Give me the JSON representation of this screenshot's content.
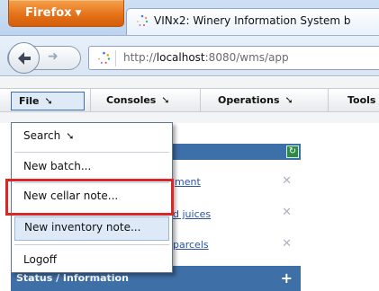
{
  "browser": {
    "firefox_button": "Firefox",
    "tab_title": "VINx2: Winery Information System b",
    "url_prefix": "http://",
    "url_host": "localhost",
    "url_rest": ":8080/wms/app"
  },
  "menubar": {
    "file": "File",
    "consoles": "Consoles",
    "operations": "Operations",
    "tools": "Tools"
  },
  "file_menu": {
    "search": "Search",
    "new_batch": "New batch...",
    "new_cellar_note": "New cellar note...",
    "new_inventory_note": "New inventory note...",
    "logoff": "Logoff"
  },
  "panel": {
    "link1": "ment",
    "link2": "d juices",
    "link3": "parcels"
  },
  "status": {
    "title": "Status / Information",
    "expand": "+"
  },
  "colors": {
    "firefox_orange": "#e36f16",
    "panel_blue": "#3d6fa8",
    "highlight_red": "#d92626",
    "hover_blue": "#dde9f6"
  },
  "icons": {
    "dropdown_arrow": "chevron-down-icon",
    "menu_arrow": "diagonal-arrow-icon",
    "back": "back-arrow-icon",
    "forward": "forward-arrow-icon",
    "favicon": "loading-favicon",
    "refresh": "refresh-icon",
    "close": "close-icon"
  }
}
